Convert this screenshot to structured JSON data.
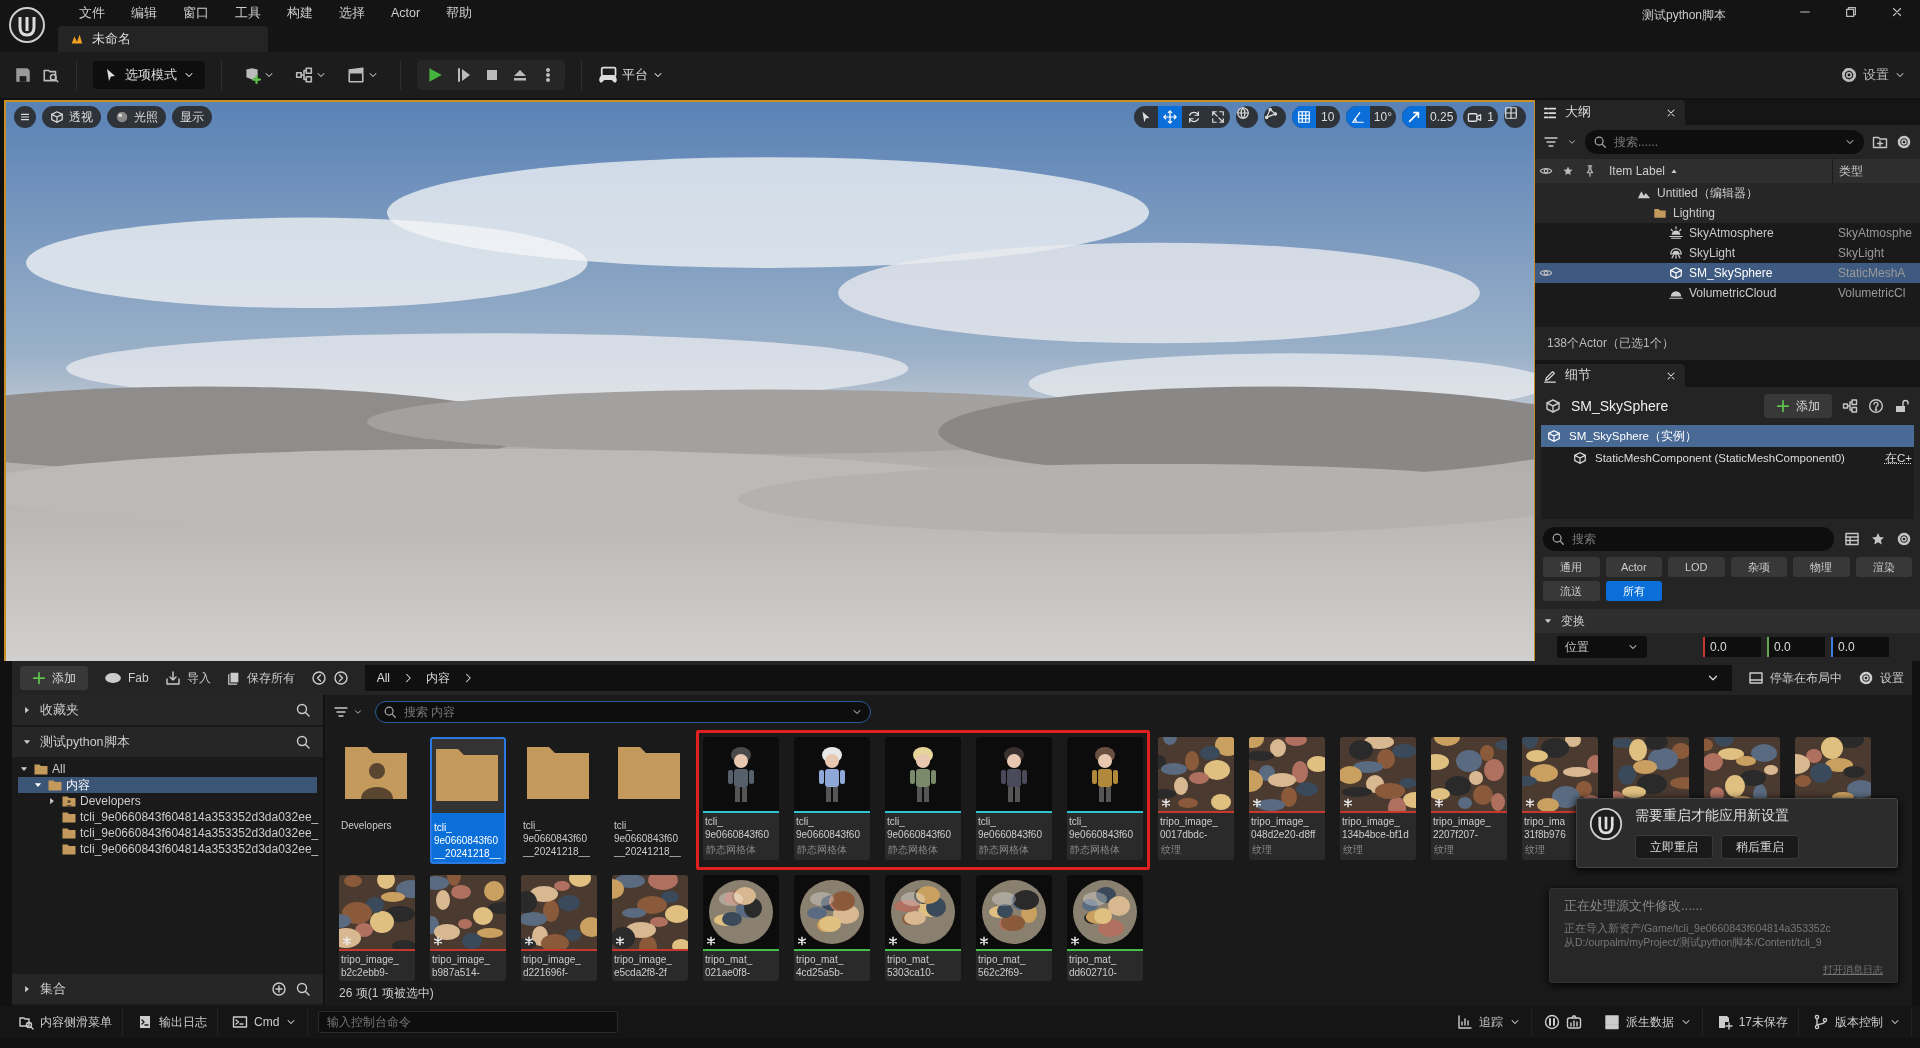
{
  "menu_bar": {
    "menus": [
      "文件",
      "编辑",
      "窗口",
      "工具",
      "构建",
      "选择",
      "Actor",
      "帮助"
    ],
    "project": "测试python脚本"
  },
  "document_tab": {
    "label": "未命名"
  },
  "toolbar": {
    "mode": "选项模式",
    "platform": "平台",
    "settings": "设置"
  },
  "viewport": {
    "buttons": [
      {
        "kind": "perspective",
        "label": "透视"
      },
      {
        "kind": "lighting",
        "label": "光照"
      },
      {
        "kind": "show",
        "label": "显示"
      }
    ],
    "transform_tools": [
      {
        "kind": "select",
        "selected": false
      },
      {
        "kind": "move",
        "selected": true
      },
      {
        "kind": "rotate",
        "selected": false
      },
      {
        "kind": "scale",
        "selected": false
      }
    ],
    "snaps": [
      {
        "kind": "grid",
        "on": true,
        "value": "10"
      },
      {
        "kind": "angle",
        "on": true,
        "value": "10°"
      },
      {
        "kind": "scale",
        "on": true,
        "value": "0.25"
      }
    ],
    "camera_speed": "1"
  },
  "outliner": {
    "title": "大纲",
    "search_placeholder": "搜索......",
    "columns": [
      "Item Label",
      "类型"
    ],
    "tree": [
      {
        "label": "Untitled（编辑器）",
        "kind": "world",
        "visible": false,
        "selected": false,
        "children": [
          {
            "label": "Lighting",
            "kind": "folder",
            "visible": false,
            "selected": false,
            "children": [
              {
                "label": "SkyAtmosphere",
                "type": "SkyAtmosphe",
                "kind": "atmosphere",
                "visible": false,
                "selected": false
              },
              {
                "label": "SkyLight",
                "type": "SkyLight",
                "kind": "skylight",
                "visible": false,
                "selected": false
              },
              {
                "label": "SM_SkySphere",
                "type": "StaticMeshA",
                "kind": "mesh",
                "visible": true,
                "selected": true
              },
              {
                "label": "VolumetricCloud",
                "type": "VolumetricCl",
                "kind": "cloud",
                "visible": false,
                "selected": false
              }
            ]
          }
        ]
      }
    ],
    "summary": "138个Actor（已选1个）"
  },
  "details": {
    "title": "细节",
    "actor": "SM_SkySphere",
    "add": "添加",
    "components": [
      {
        "label": "SM_SkySphere（实例）",
        "selected": true,
        "children": [
          {
            "label": "StaticMeshComponent (StaticMeshComponent0)",
            "note": "在C+",
            "selected": false
          }
        ]
      }
    ],
    "search_placeholder": "搜索",
    "filters": [
      {
        "label": "通用",
        "selected": false
      },
      {
        "label": "Actor",
        "selected": false
      },
      {
        "label": "LOD",
        "selected": false
      },
      {
        "label": "杂项",
        "selected": false
      },
      {
        "label": "物理",
        "selected": false
      },
      {
        "label": "渲染",
        "selected": false
      },
      {
        "label": "流送",
        "selected": false
      },
      {
        "label": "所有",
        "selected": true
      }
    ],
    "section": {
      "label": "变换",
      "expanded": true
    },
    "property": {
      "label": "位置",
      "values": [
        {
          "value": "0.0",
          "color": "#c0392b"
        },
        {
          "value": "0.0",
          "color": "#6aa84f"
        },
        {
          "value": "0.0",
          "color": "#3d7ed8"
        }
      ]
    }
  },
  "content_browser": {
    "add": "添加",
    "fab": "Fab",
    "import": "导入",
    "save_all": "保存所有",
    "breadcrumb": [
      "All",
      "内容"
    ],
    "dock": "停靠在布局中",
    "settings": "设置",
    "sources": [
      {
        "label": "收藏夹",
        "expanded": false
      },
      {
        "label": "测试python脚本",
        "expanded": true
      }
    ],
    "tree": [
      {
        "label": "All",
        "expanded": true,
        "selected": false,
        "children": [
          {
            "label": "内容",
            "expanded": true,
            "selected": true,
            "children": [
              {
                "label": "Developers",
                "kind": "user_folder",
                "expanded": false,
                "selected": false
              },
              {
                "label": "tcli_9e0660843f604814a353352d3da032ee_",
                "kind": "folder",
                "selected": false
              },
              {
                "label": "tcli_9e0660843f604814a353352d3da032ee_",
                "kind": "folder",
                "selected": false
              },
              {
                "label": "tcli_9e0660843f604814a353352d3da032ee_",
                "kind": "folder",
                "selected": false
              }
            ]
          }
        ]
      }
    ],
    "collections": "集合",
    "search_placeholder": "搜索 内容",
    "assets": [
      {
        "kind": "user_folder",
        "lines": [
          "Developers"
        ],
        "selected": false,
        "highlighted": false
      },
      {
        "kind": "folder",
        "lines": [
          "tcli_",
          "9e0660843f60",
          "__20241218__"
        ],
        "selected": true,
        "highlighted": false
      },
      {
        "kind": "folder",
        "lines": [
          "tcli_",
          "9e0660843f60",
          "__20241218__"
        ],
        "selected": false,
        "highlighted": false
      },
      {
        "kind": "folder",
        "lines": [
          "tcli_",
          "9e0660843f60",
          "__20241218__"
        ],
        "selected": false,
        "highlighted": false
      },
      {
        "kind": "mesh",
        "lines": [
          "tcli_",
          "9e0660843f60"
        ],
        "type": "静态网格体",
        "selected": false,
        "highlighted": true
      },
      {
        "kind": "mesh",
        "lines": [
          "tcli_",
          "9e0660843f60"
        ],
        "type": "静态网格体",
        "selected": false,
        "highlighted": true
      },
      {
        "kind": "mesh",
        "lines": [
          "tcli_",
          "9e0660843f60"
        ],
        "type": "静态网格体",
        "selected": false,
        "highlighted": true
      },
      {
        "kind": "mesh",
        "lines": [
          "tcli_",
          "9e0660843f60"
        ],
        "type": "静态网格体",
        "selected": false,
        "highlighted": true
      },
      {
        "kind": "mesh",
        "lines": [
          "tcli_",
          "9e0660843f60"
        ],
        "type": "静态网格体",
        "selected": false,
        "highlighted": true
      },
      {
        "kind": "texture",
        "lines": [
          "tripo_image_",
          "0017dbdc-"
        ],
        "type": "纹理",
        "selected": false,
        "highlighted": false
      },
      {
        "kind": "texture",
        "lines": [
          "tripo_image_",
          "048d2e20-d8ff"
        ],
        "type": "纹理",
        "selected": false,
        "highlighted": false
      },
      {
        "kind": "texture",
        "lines": [
          "tripo_image_",
          "134b4bce-bf1d"
        ],
        "type": "纹理",
        "selected": false,
        "highlighted": false
      },
      {
        "kind": "texture",
        "lines": [
          "tripo_image_",
          "2207f207-"
        ],
        "type": "纹理",
        "selected": false,
        "highlighted": false
      },
      {
        "kind": "texture",
        "lines": [
          "tripo_ima",
          "31f8b976"
        ],
        "type": "纹理",
        "selected": false,
        "highlighted": false
      },
      {
        "kind": "texture",
        "selected": false,
        "highlighted": false
      },
      {
        "kind": "texture",
        "selected": false,
        "highlighted": false
      },
      {
        "kind": "texture",
        "selected": false,
        "highlighted": false
      },
      {
        "kind": "texture",
        "lines": [
          "tripo_image_",
          "b2c2ebb9-"
        ],
        "selected": false,
        "highlighted": false
      },
      {
        "kind": "texture",
        "lines": [
          "tripo_image_",
          "b987a514-"
        ],
        "selected": false,
        "highlighted": false
      },
      {
        "kind": "texture",
        "lines": [
          "tripo_image_",
          "d221696f-"
        ],
        "selected": false,
        "highlighted": false
      },
      {
        "kind": "texture",
        "lines": [
          "tripo_image_",
          "e5cda2f8-2f"
        ],
        "selected": false,
        "highlighted": false
      },
      {
        "kind": "material",
        "lines": [
          "tripo_mat_",
          "021ae0f8-"
        ],
        "selected": false,
        "highlighted": false
      },
      {
        "kind": "material",
        "lines": [
          "tripo_mat_",
          "4cd25a5b-"
        ],
        "selected": false,
        "highlighted": false
      },
      {
        "kind": "material",
        "lines": [
          "tripo_mat_",
          "5303ca10-"
        ],
        "selected": false,
        "highlighted": false
      },
      {
        "kind": "material",
        "lines": [
          "tripo_mat_",
          "562c2f69-"
        ],
        "selected": false,
        "highlighted": false
      },
      {
        "kind": "material",
        "lines": [
          "tripo_mat_",
          "dd602710-"
        ],
        "selected": false,
        "highlighted": false
      }
    ],
    "count": "26 项(1 项被选中)"
  },
  "notifications": [
    {
      "kind": "prompt",
      "message": "需要重启才能应用新设置",
      "buttons": [
        "立即重启",
        "稍后重启"
      ]
    },
    {
      "kind": "progress",
      "message": "正在处理源文件修改......",
      "details": [
        "正在导入新资产/Game/tcli_9e0660843f604814a353352c",
        "从D:/ourpalm/myProject/测试python脚本/Content/tcli_9"
      ],
      "link": "打开消息日志"
    }
  ],
  "status_bar": {
    "left": [
      {
        "kind": "drawer",
        "label": "内容侧滑菜单"
      },
      {
        "kind": "log",
        "label": "输出日志"
      },
      {
        "kind": "cmd",
        "label": "Cmd"
      }
    ],
    "console_placeholder": "输入控制台命令",
    "right": [
      {
        "kind": "trace",
        "label": "追踪"
      },
      {
        "kind": "ddc",
        "label": "派生数据"
      },
      {
        "kind": "unsaved",
        "label": "17未保存"
      },
      {
        "kind": "vcs",
        "label": "版本控制"
      }
    ]
  }
}
